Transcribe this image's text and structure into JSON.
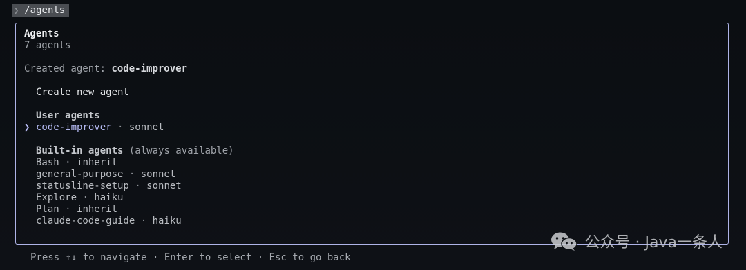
{
  "prompt": {
    "command": "/agents"
  },
  "panel": {
    "title": "Agents",
    "count": "7 agents",
    "created_prefix": "Created agent: ",
    "created_name": "code-improver",
    "create_new": "Create new agent",
    "user_section": {
      "title": "User agents"
    },
    "user_agents": [
      {
        "name": "code-improver",
        "model": "sonnet",
        "selected": true
      }
    ],
    "builtin_section": {
      "title": "Built-in agents",
      "note": " (always available)"
    },
    "builtin_agents": [
      {
        "name": "Bash",
        "model": "inherit"
      },
      {
        "name": "general-purpose",
        "model": "sonnet"
      },
      {
        "name": "statusline-setup",
        "model": "sonnet"
      },
      {
        "name": "Explore",
        "model": "haiku"
      },
      {
        "name": "Plan",
        "model": "inherit"
      },
      {
        "name": "claude-code-guide",
        "model": "haiku"
      }
    ],
    "separator": " · ",
    "cursor_glyph": "❯"
  },
  "footer": {
    "hint": "Press ↑↓ to navigate · Enter to select · Esc to go back"
  },
  "watermark": {
    "text": "公众号 · Java一条人",
    "icon": "wechat-icon"
  },
  "colors": {
    "border": "#aeb3e6",
    "selected": "#b3b8f0",
    "background": "#0d1014"
  }
}
